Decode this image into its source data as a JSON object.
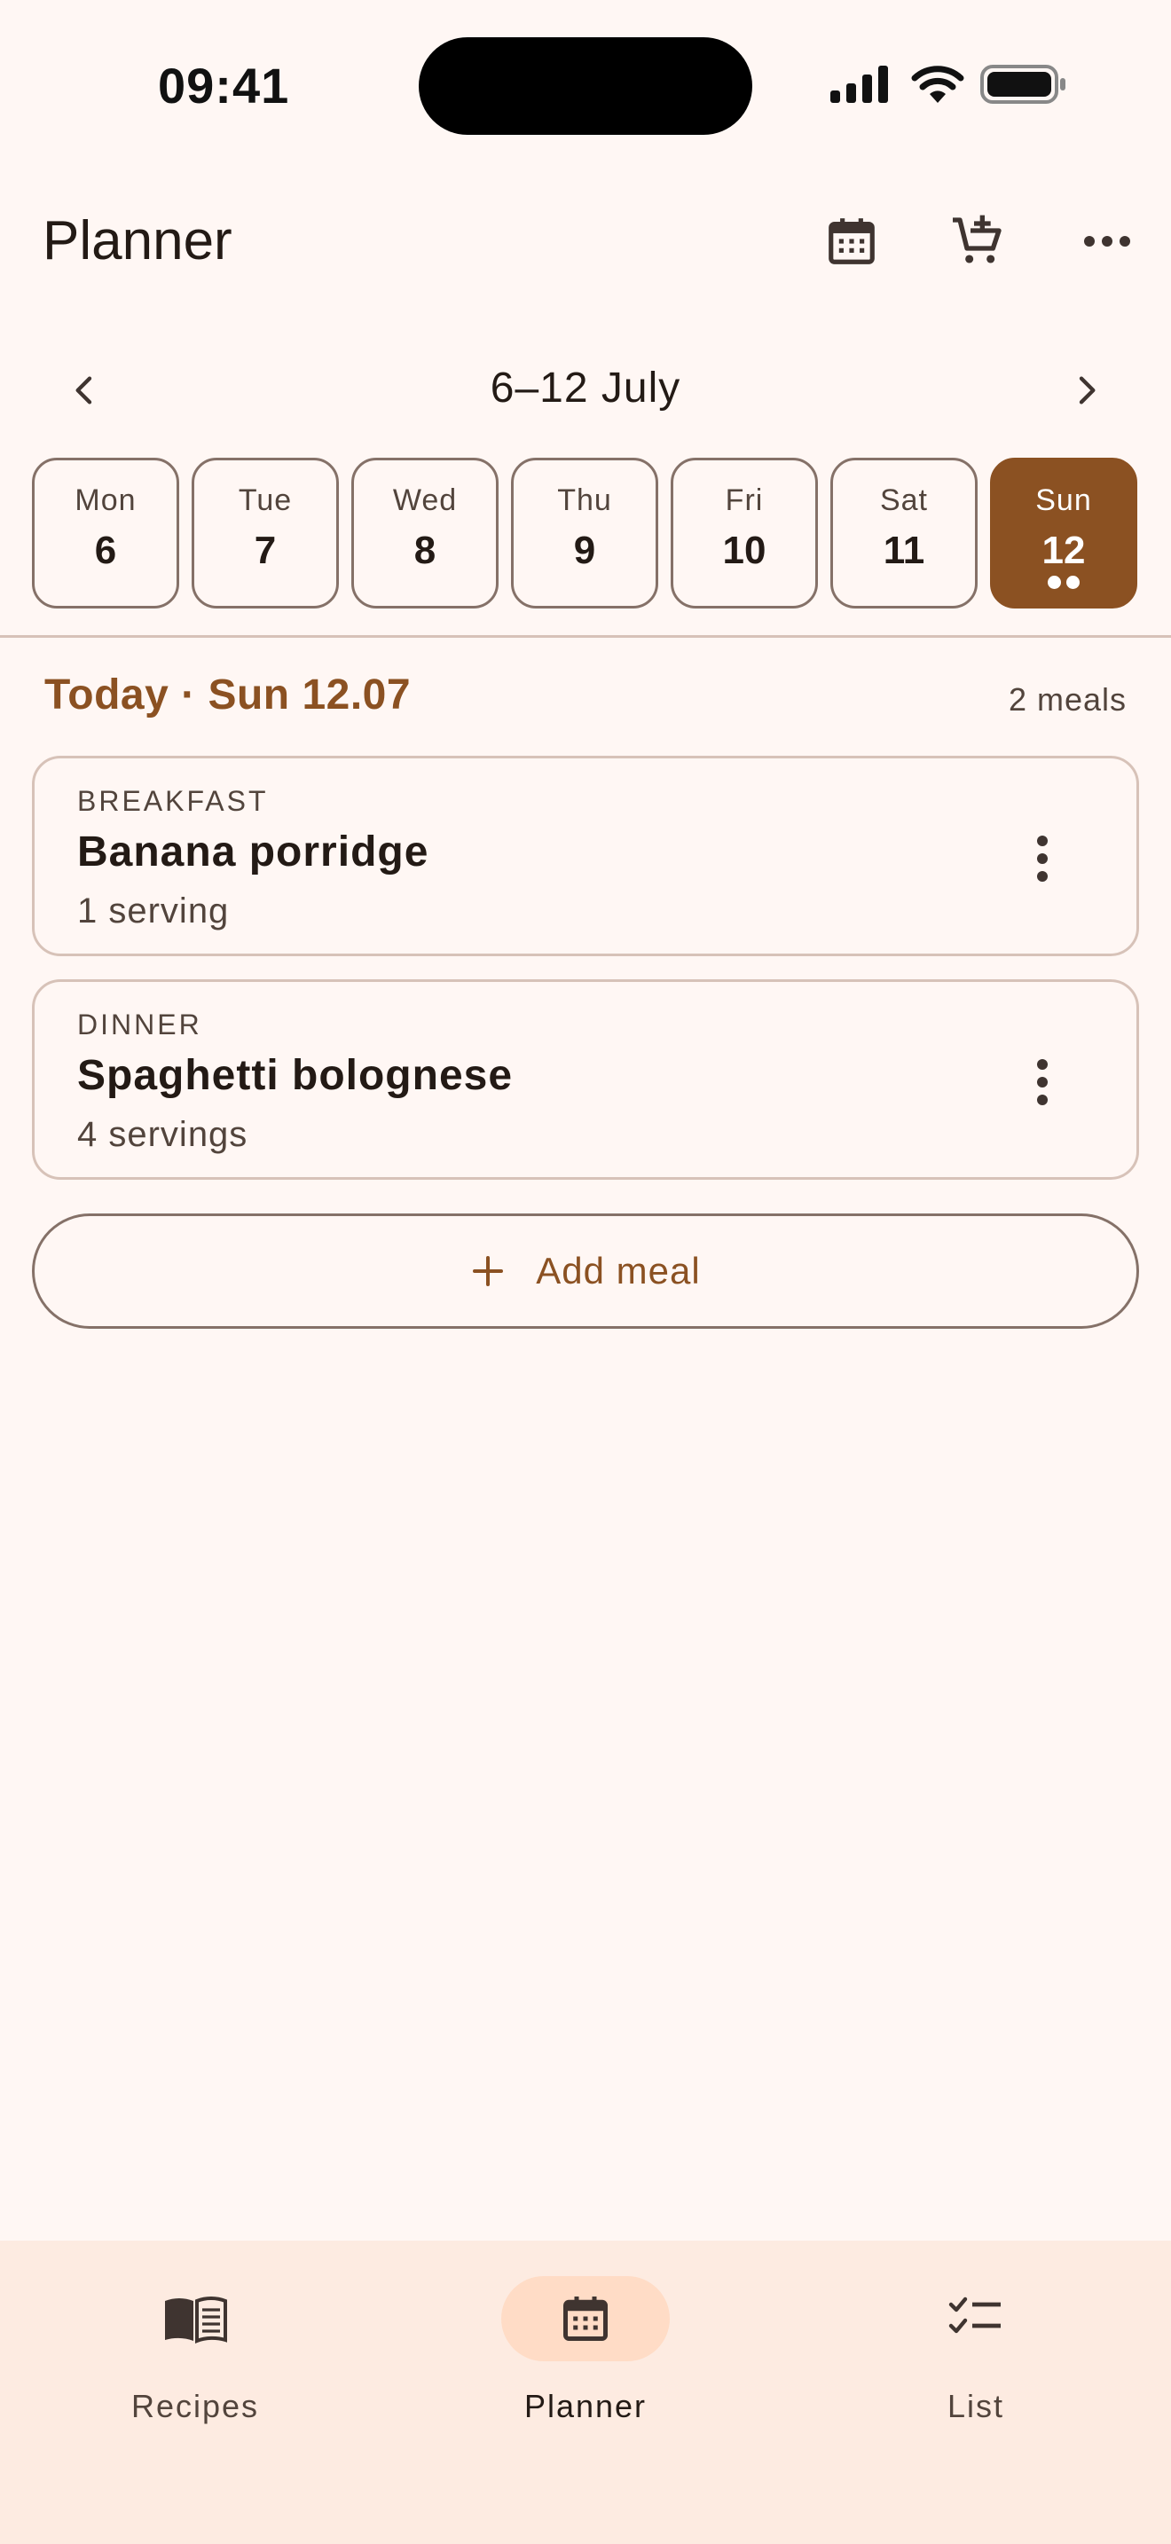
{
  "status_bar": {
    "time": "09:41",
    "icons": [
      "signal-icon",
      "wifi-icon",
      "battery-icon"
    ]
  },
  "app_bar": {
    "title": "Planner",
    "actions": [
      "calendar-icon",
      "add-to-cart-icon",
      "more-horizontal-icon"
    ]
  },
  "week_nav": {
    "label": "6–12 July"
  },
  "days": [
    {
      "name": "Mon",
      "num": "6"
    },
    {
      "name": "Tue",
      "num": "7"
    },
    {
      "name": "Wed",
      "num": "8"
    },
    {
      "name": "Thu",
      "num": "9"
    },
    {
      "name": "Fri",
      "num": "10"
    },
    {
      "name": "Sat",
      "num": "11"
    },
    {
      "name": "Sun",
      "num": "12"
    }
  ],
  "selected_day_index": 6,
  "day_section": {
    "heading": "Today · Sun 12.07",
    "meal_count": "2 meals"
  },
  "meals": [
    {
      "type": "BREAKFAST",
      "name": "Banana porridge",
      "servings": "1 serving"
    },
    {
      "type": "DINNER",
      "name": "Spaghetti bolognese",
      "servings": "4 servings"
    }
  ],
  "add_meal": {
    "label": "Add meal"
  },
  "bottom_nav": {
    "items": [
      {
        "label": "Recipes",
        "icon": "book-icon"
      },
      {
        "label": "Planner",
        "icon": "calendar-icon"
      },
      {
        "label": "List",
        "icon": "checklist-icon"
      }
    ],
    "active_index": 1
  },
  "colors": {
    "background": "#FFF7F4",
    "primary": "#8B5122",
    "outline": "#857168",
    "outline_variant": "#D7C2B8",
    "nav_background": "#FDEBE1",
    "nav_indicator": "#FFDCC6"
  }
}
